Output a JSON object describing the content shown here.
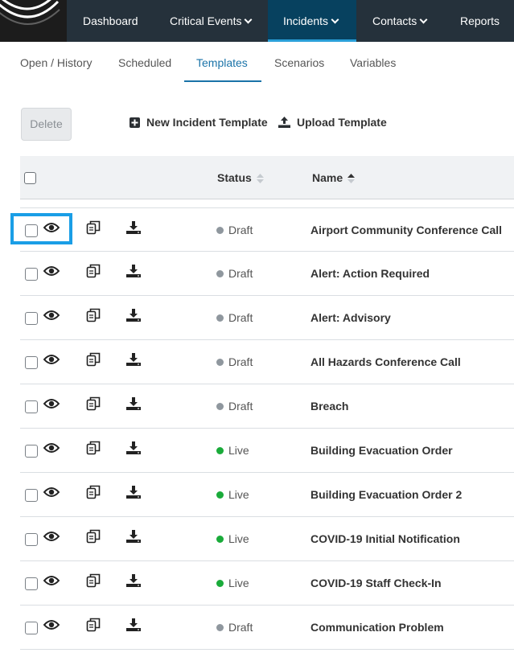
{
  "nav": {
    "items": [
      {
        "label": "Dashboard",
        "dropdown": false
      },
      {
        "label": "Critical Events",
        "dropdown": true
      },
      {
        "label": "Incidents",
        "dropdown": true,
        "active": true
      },
      {
        "label": "Contacts",
        "dropdown": true
      },
      {
        "label": "Reports",
        "dropdown": false
      }
    ]
  },
  "subtabs": [
    {
      "label": "Open / History"
    },
    {
      "label": "Scheduled"
    },
    {
      "label": "Templates",
      "active": true
    },
    {
      "label": "Scenarios"
    },
    {
      "label": "Variables"
    }
  ],
  "toolbar": {
    "delete_label": "Delete",
    "new_label": "New Incident Template",
    "upload_label": "Upload Template"
  },
  "table": {
    "headers": {
      "status": "Status",
      "name": "Name"
    },
    "rows": [
      {
        "status": "Draft",
        "name": "Airport Community Conference Call"
      },
      {
        "status": "Draft",
        "name": "Alert: Action Required"
      },
      {
        "status": "Draft",
        "name": "Alert: Advisory"
      },
      {
        "status": "Draft",
        "name": "All Hazards Conference Call"
      },
      {
        "status": "Draft",
        "name": "Breach"
      },
      {
        "status": "Live",
        "name": "Building Evacuation Order"
      },
      {
        "status": "Live",
        "name": "Building Evacuation Order 2"
      },
      {
        "status": "Live",
        "name": "COVID-19 Initial Notification"
      },
      {
        "status": "Live",
        "name": "COVID-19 Staff Check-In"
      },
      {
        "status": "Draft",
        "name": "Communication Problem"
      }
    ]
  },
  "colors": {
    "nav_bg": "#25313b",
    "nav_active": "#07415f",
    "accent": "#1a73a8",
    "draft_dot": "#8f979e",
    "live_dot": "#1aab3a",
    "highlight": "#1a9ee6"
  },
  "icons": [
    "logo-icon",
    "chevron-down-icon",
    "plus-square-icon",
    "upload-icon",
    "sort-icon",
    "eye-icon",
    "copy-icon",
    "download-icon"
  ]
}
